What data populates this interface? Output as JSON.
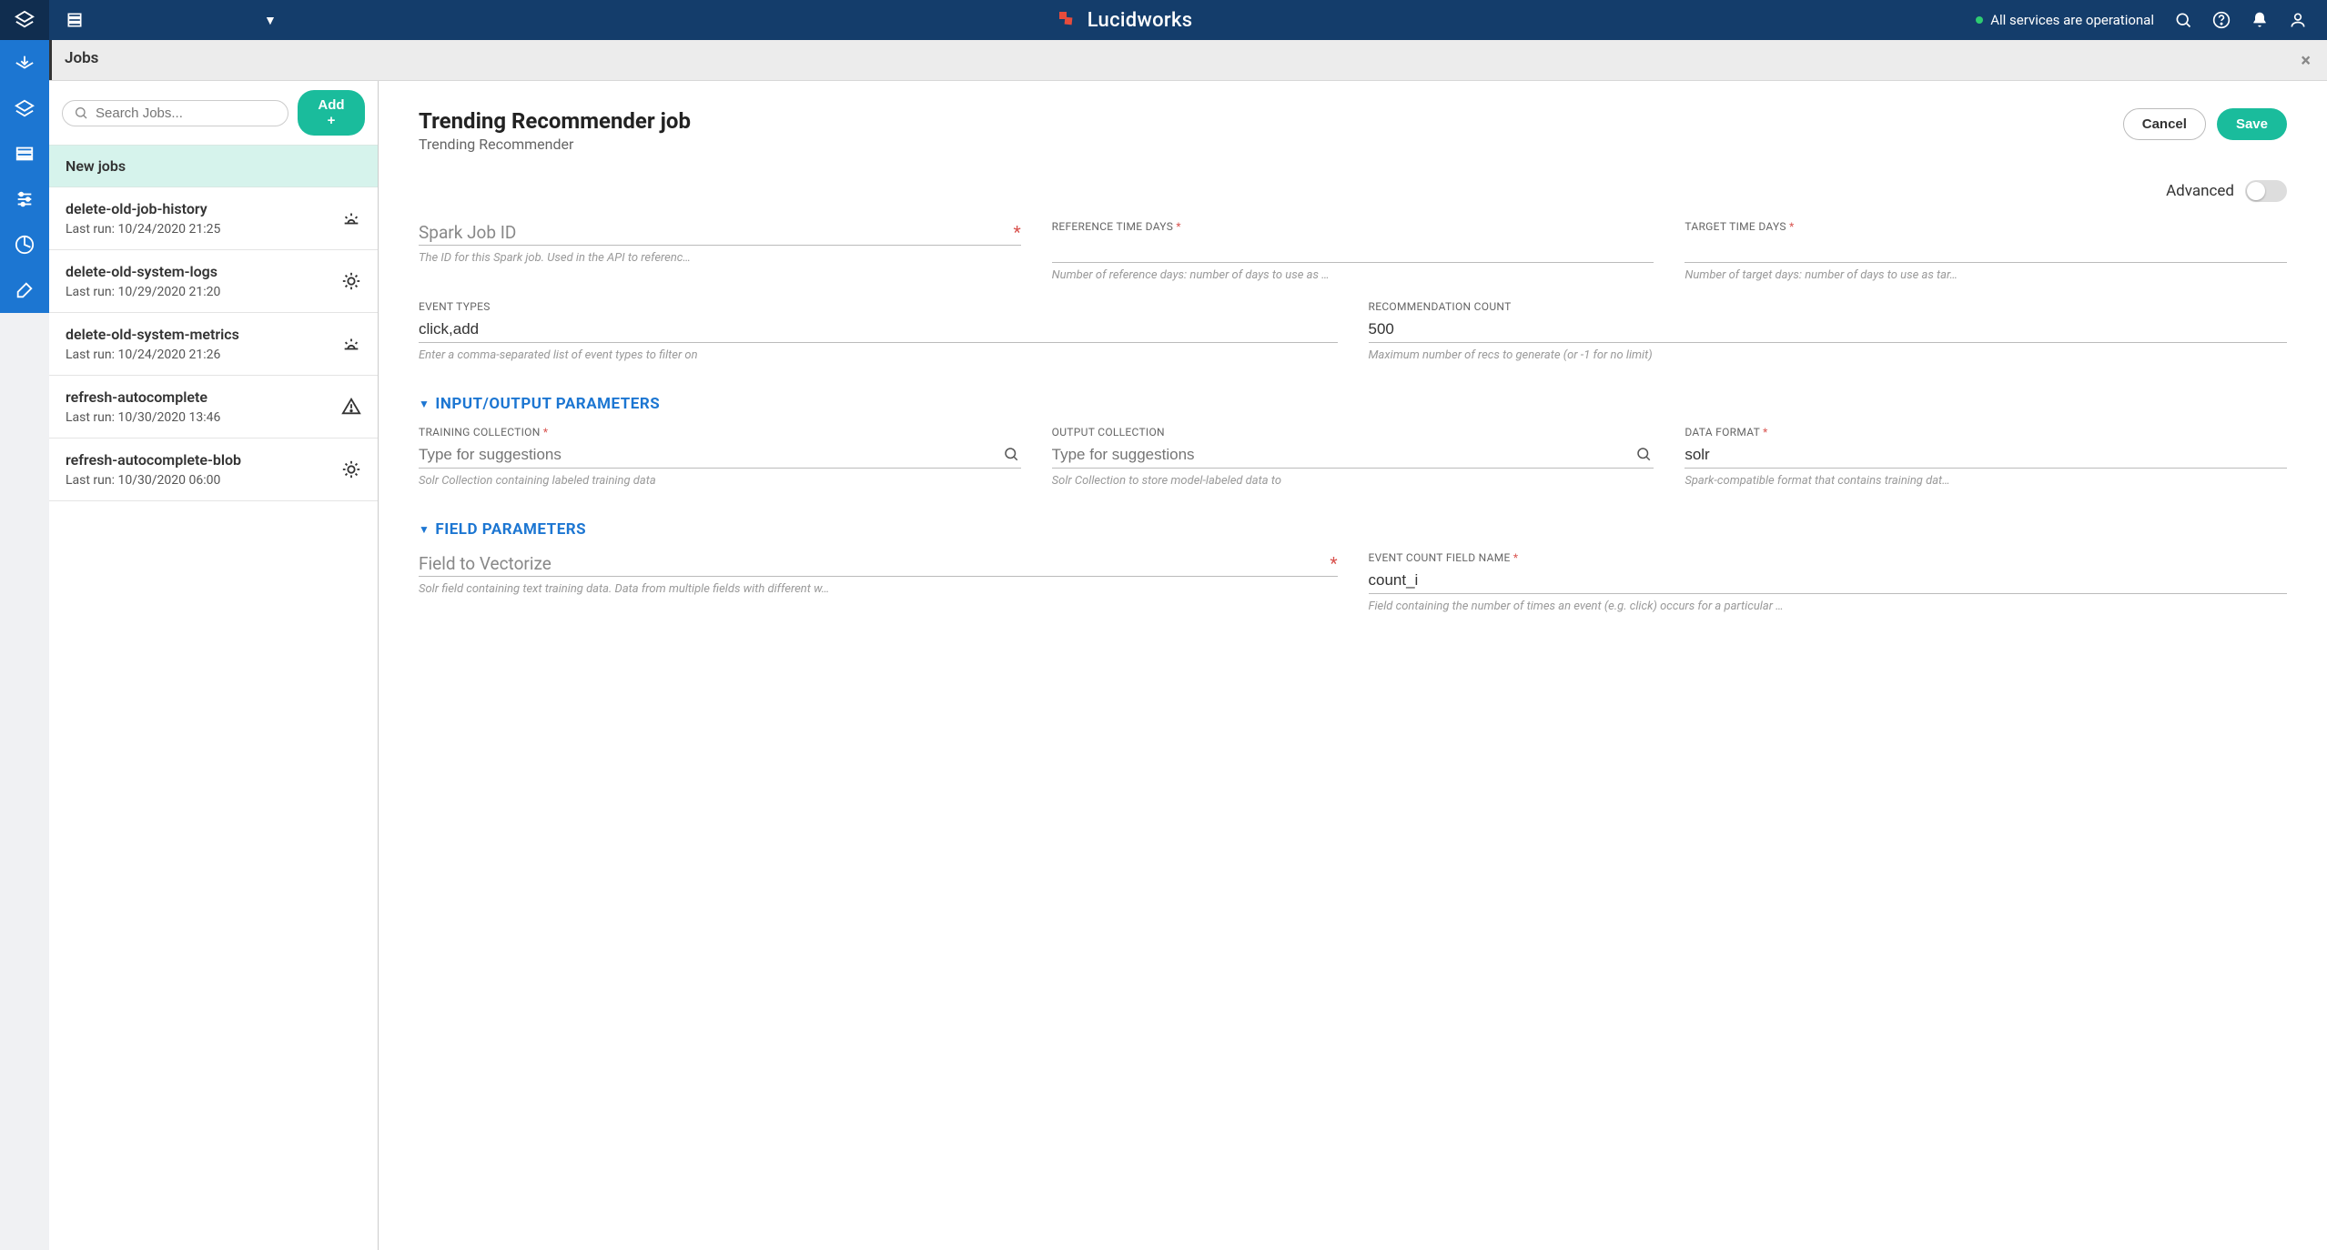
{
  "topbar": {
    "brand": "Lucidworks",
    "status_text": "All services are operational"
  },
  "panel": {
    "title": "Jobs",
    "search_placeholder": "Search Jobs...",
    "add_label": "Add +",
    "section_label": "New jobs"
  },
  "jobs": [
    {
      "name": "delete-old-job-history",
      "meta": "Last run: 10/24/2020 21:25",
      "status": "sunrise"
    },
    {
      "name": "delete-old-system-logs",
      "meta": "Last run: 10/29/2020 21:20",
      "status": "sun"
    },
    {
      "name": "delete-old-system-metrics",
      "meta": "Last run: 10/24/2020 21:26",
      "status": "sunrise"
    },
    {
      "name": "refresh-autocomplete",
      "meta": "Last run: 10/30/2020 13:46",
      "status": "warning"
    },
    {
      "name": "refresh-autocomplete-blob",
      "meta": "Last run: 10/30/2020 06:00",
      "status": "sun"
    }
  ],
  "content": {
    "title": "Trending Recommender job",
    "subtitle": "Trending Recommender",
    "cancel": "Cancel",
    "save": "Save",
    "advanced": "Advanced"
  },
  "fields": {
    "spark_id": {
      "placeholder": "Spark Job ID",
      "help": "The ID for this Spark job. Used in the API to referenc…"
    },
    "ref_days": {
      "label": "REFERENCE TIME DAYS",
      "help": "Number of reference days: number of days to use as …"
    },
    "tgt_days": {
      "label": "TARGET TIME DAYS",
      "help": "Number of target days: number of days to use as tar…"
    },
    "event_types": {
      "label": "EVENT TYPES",
      "value": "click,add",
      "help": "Enter a comma-separated list of event types to filter on"
    },
    "rec_count": {
      "label": "RECOMMENDATION COUNT",
      "value": "500",
      "help": "Maximum number of recs to generate (or -1 for no limit)"
    },
    "sec_io": "INPUT/OUTPUT PARAMETERS",
    "training": {
      "label": "TRAINING COLLECTION",
      "placeholder": "Type for suggestions",
      "help": "Solr Collection containing labeled training data"
    },
    "output": {
      "label": "OUTPUT COLLECTION",
      "placeholder": "Type for suggestions",
      "help": "Solr Collection to store model-labeled data to"
    },
    "format": {
      "label": "DATA FORMAT",
      "value": "solr",
      "help": "Spark-compatible format that contains training dat…"
    },
    "sec_fld": "FIELD PARAMETERS",
    "vectorize": {
      "placeholder": "Field to Vectorize",
      "help": "Solr field containing text training data. Data from multiple fields with different w…"
    },
    "countfld": {
      "label": "EVENT COUNT FIELD NAME",
      "value": "count_i",
      "help": "Field containing the number of times an event (e.g. click) occurs for a particular …"
    }
  }
}
